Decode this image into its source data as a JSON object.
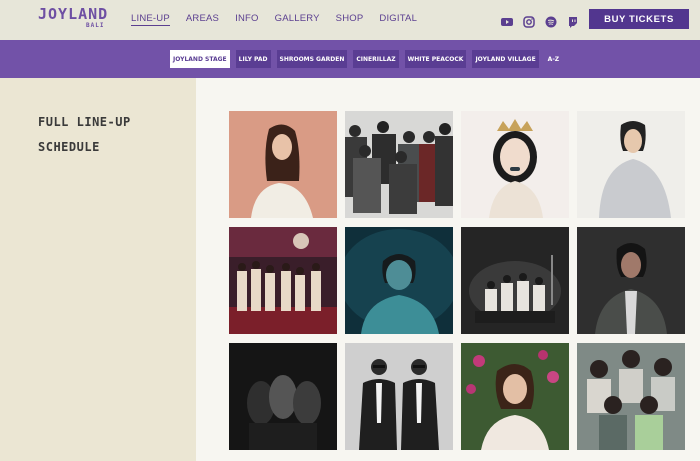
{
  "logo": {
    "main": "JOYLAND",
    "sub": "BALI"
  },
  "nav": [
    "LINE-UP",
    "AREAS",
    "INFO",
    "GALLERY",
    "SHOP",
    "DIGITAL"
  ],
  "socials": [
    "youtube-icon",
    "instagram-icon",
    "spotify-icon",
    "twitch-icon"
  ],
  "buy_tickets": "BUY TICKETS",
  "stages": [
    "JOYLAND STAGE",
    "LILY PAD",
    "SHROOMS GARDEN",
    "CINERILLAZ",
    "WHITE PEACOCK",
    "JOYLAND VILLAGE",
    "A-Z"
  ],
  "sidebar": {
    "title_line1": "FULL LINE-UP",
    "title_line2": "SCHEDULE"
  },
  "colors": {
    "brand": "#6e4fa3",
    "stage_bar": "#7252a8",
    "button": "#52368f",
    "header_bg": "#e7e6d9",
    "sidebar_bg": "#ebe6d3"
  }
}
